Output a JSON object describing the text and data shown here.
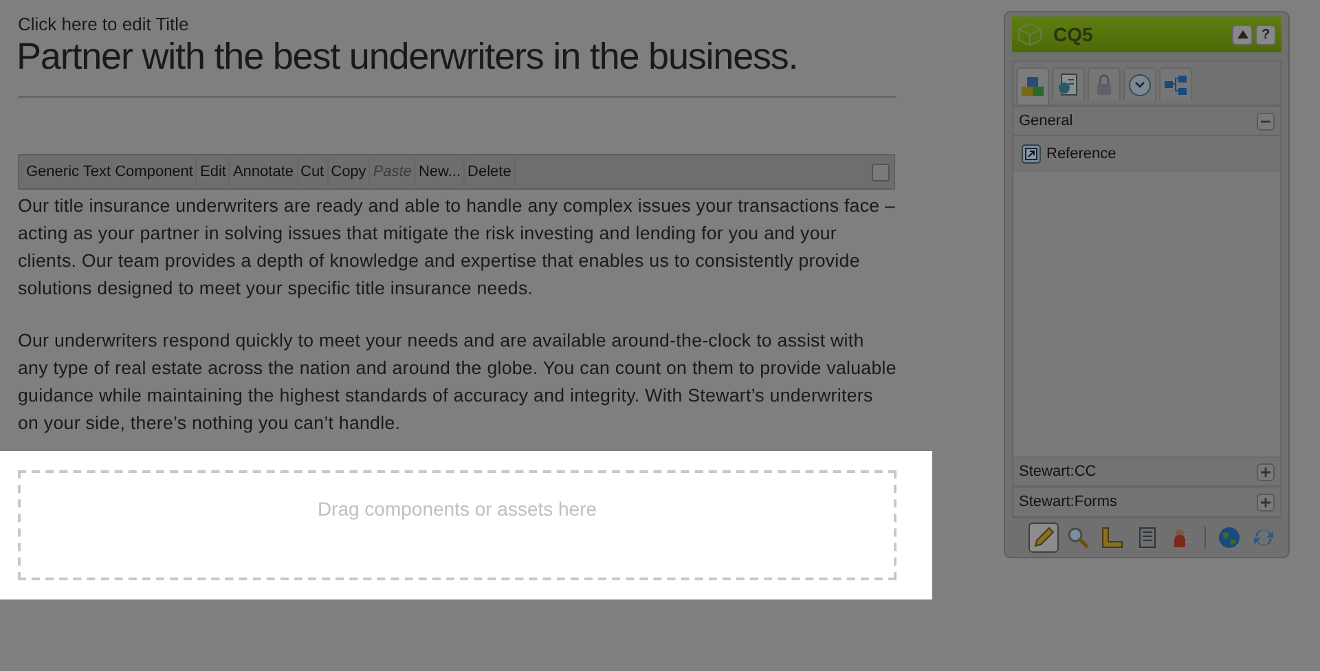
{
  "title_hint": "Click here to edit Title",
  "heading": "Partner with the best underwriters in the business.",
  "toolbar": {
    "buttons": [
      {
        "label": "Generic Text Component",
        "disabled": false
      },
      {
        "label": "Edit",
        "disabled": false
      },
      {
        "label": "Annotate",
        "disabled": false
      },
      {
        "label": "Cut",
        "disabled": false
      },
      {
        "label": "Copy",
        "disabled": false
      },
      {
        "label": "Paste",
        "disabled": true
      },
      {
        "label": "New...",
        "disabled": false
      },
      {
        "label": "Delete",
        "disabled": false
      }
    ],
    "checkbox": {
      "checked": false
    }
  },
  "paragraphs": [
    "Our title insurance underwriters are ready and able to handle any complex issues your transactions face – acting as your partner in solving issues that mitigate the risk investing and lending for you and your clients. Our team provides a depth of knowledge and expertise that enables us to consistently provide solutions designed to meet your specific title insurance needs.",
    "Our underwriters respond quickly to meet your needs and are available around-the-clock to assist with any type of real estate across the nation and around the globe. You can count on them to provide valuable guidance while maintaining the highest standards of accuracy and integrity. With Stewart’s underwriters on your side, there’s nothing you can’t handle."
  ],
  "drop_zone": {
    "text": "Drag components or assets here"
  },
  "sidekick": {
    "title": "CQ5",
    "help": "?",
    "tabs": [
      {
        "kind": "components",
        "selected": true
      },
      {
        "kind": "page",
        "selected": false
      },
      {
        "kind": "lock",
        "selected": false
      },
      {
        "kind": "clock",
        "selected": false
      },
      {
        "kind": "workflow",
        "selected": false
      }
    ],
    "sections": [
      {
        "label": "General",
        "expanded": true,
        "items": [
          {
            "label": "Reference"
          }
        ]
      },
      {
        "label": "Stewart:CC",
        "expanded": false
      },
      {
        "label": "Stewart:Forms",
        "expanded": false
      }
    ],
    "tools": [
      {
        "kind": "pencil",
        "selected": true
      },
      {
        "kind": "magnifier",
        "selected": false
      },
      {
        "kind": "ruler",
        "selected": false
      },
      {
        "kind": "document",
        "selected": false
      },
      {
        "kind": "person",
        "selected": false
      },
      {
        "kind": "separator"
      },
      {
        "kind": "globe",
        "selected": false
      },
      {
        "kind": "refresh",
        "selected": false
      }
    ]
  }
}
